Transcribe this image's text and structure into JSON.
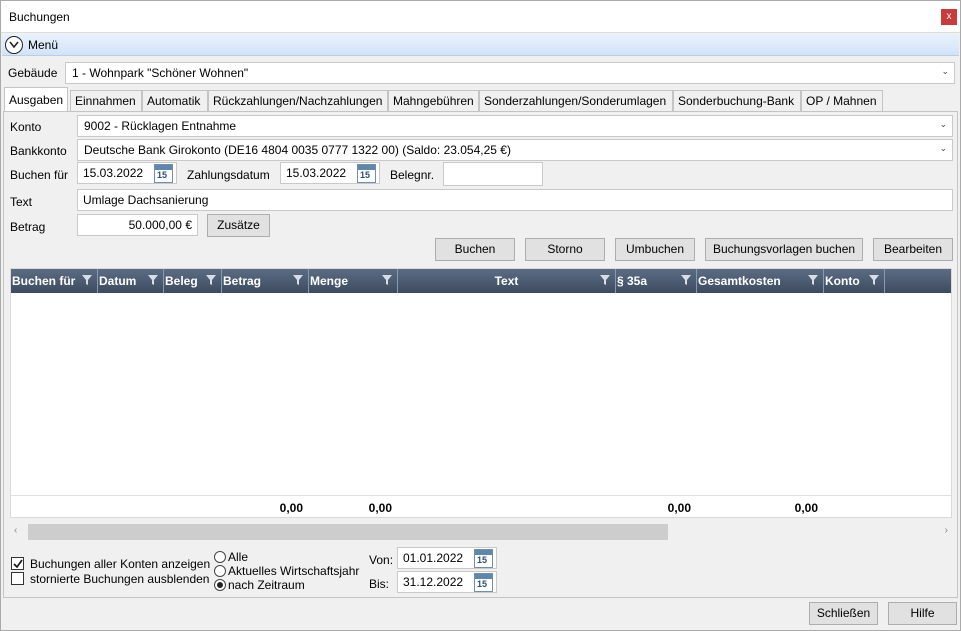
{
  "window": {
    "title": "Buchungen",
    "close": "x"
  },
  "menu": {
    "label": "Menü"
  },
  "gebaeude": {
    "label": "Gebäude",
    "value": "1 - Wohnpark \"Schöner Wohnen\""
  },
  "tabs": [
    "Ausgaben",
    "Einnahmen",
    "Automatik",
    "Rückzahlungen/Nachzahlungen",
    "Mahngebühren",
    "Sonderzahlungen/Sonderumlagen",
    "Sonderbuchung-Bank",
    "OP / Mahnen"
  ],
  "form": {
    "konto_label": "Konto",
    "konto_value": "9002 - Rücklagen Entnahme",
    "bankkonto_label": "Bankkonto",
    "bankkonto_value": "Deutsche Bank Girokonto (DE16 4804 0035 0777 1322 00) (Saldo: 23.054,25 €)",
    "buchen_fuer_label": "Buchen für",
    "buchen_fuer_value": "15.03.2022",
    "zahlungsdatum_label": "Zahlungsdatum",
    "zahlungsdatum_value": "15.03.2022",
    "belegnr_label": "Belegnr.",
    "belegnr_value": "",
    "text_label": "Text",
    "text_value": "Umlage Dachsanierung",
    "betrag_label": "Betrag",
    "betrag_value": "50.000,00 €",
    "zusaetze_label": "Zusätze",
    "calendar_day": "15"
  },
  "actions": [
    "Buchen",
    "Storno",
    "Umbuchen",
    "Buchungsvorlagen buchen",
    "Bearbeiten"
  ],
  "grid": {
    "columns": [
      "Buchen für",
      "Datum",
      "Beleg",
      "Betrag",
      "Menge",
      "Text",
      "§ 35a",
      "Gesamtkosten",
      "Konto"
    ],
    "totals": {
      "betrag": "0,00",
      "menge": "0,00",
      "par35a": "0,00",
      "gesamtkosten": "0,00"
    }
  },
  "options": {
    "alle_konten": "Buchungen aller Konten anzeigen",
    "alle_konten_checked": true,
    "storniert": "stornierte Buchungen ausblenden",
    "storniert_checked": false,
    "radio_alle": "Alle",
    "radio_wirtschaftsjahr": "Aktuelles Wirtschaftsjahr",
    "radio_zeitraum": "nach Zeitraum",
    "selected_radio": "nach Zeitraum",
    "von_label": "Von:",
    "von_value": "01.01.2022",
    "bis_label": "Bis:",
    "bis_value": "31.12.2022"
  },
  "footer": {
    "close": "Schließen",
    "help": "Hilfe"
  },
  "colors": {
    "grid_header": "#4a5a6f",
    "menubar": "#dbe8f8",
    "close_button": "#c83c3c"
  }
}
